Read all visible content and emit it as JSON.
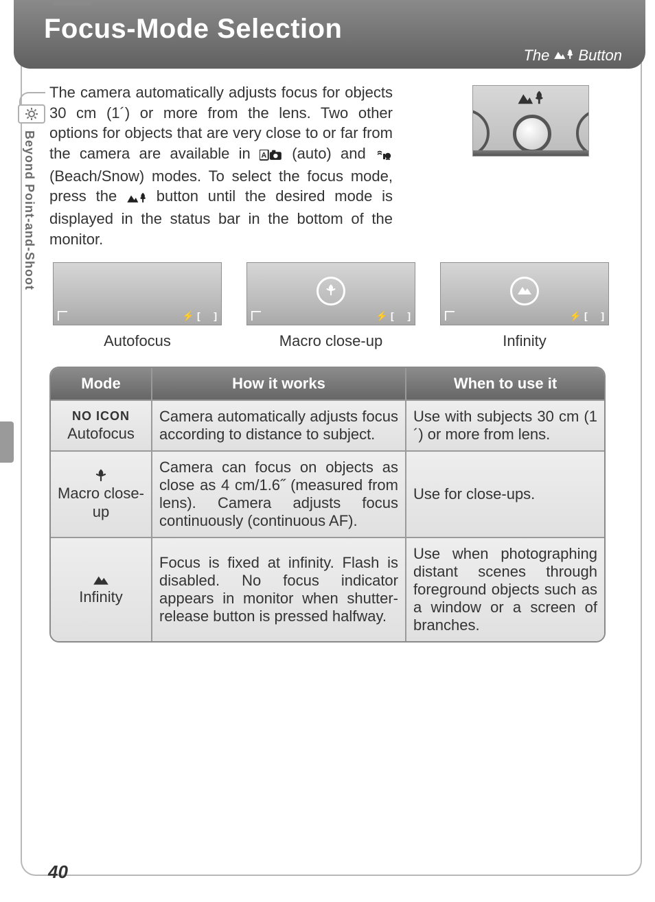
{
  "header": {
    "title": "Focus-Mode Selection",
    "subtitle_prefix": "The",
    "subtitle_suffix": "Button"
  },
  "side_tab": {
    "label": "Beyond Point-and-Shoot"
  },
  "intro": {
    "p1a": "The camera automatically adjusts focus for objects 30 cm (1´) or more from the lens.  Two other options for objects that are very close to or far from the camera are available in ",
    "p1b": " (auto) and ",
    "p1c": " (Beach/Snow) modes.  To select the focus mode, press the ",
    "p1d": " button until the desired mode is displayed in the status bar in the bottom of the monitor."
  },
  "previews": [
    {
      "label": "Autofocus",
      "center_icon": "none"
    },
    {
      "label": "Macro close-up",
      "center_icon": "macro"
    },
    {
      "label": "Infinity",
      "center_icon": "mountain"
    }
  ],
  "table": {
    "headers": {
      "mode": "Mode",
      "how": "How it works",
      "when": "When to use it"
    },
    "rows": [
      {
        "mode_icon": "none",
        "mode_top": "NO ICON",
        "mode_label": "Autofocus",
        "how": "Camera automatically adjusts focus according to distance to subject.",
        "when": "Use with subjects 30 cm (1´) or more from lens."
      },
      {
        "mode_icon": "macro",
        "mode_top": "",
        "mode_label": "Macro close-up",
        "how": "Camera can focus on objects as close as 4 cm/1.6˝ (measured from lens).  Camera adjusts focus continuously (continuous AF).",
        "when": "Use for close-ups."
      },
      {
        "mode_icon": "mountain",
        "mode_top": "",
        "mode_label": "Infinity",
        "how": "Focus is fixed at infinity.  Flash is disabled.  No focus indicator appears in monitor when shutter-release button is pressed halfway.",
        "when": "Use when photographing distant scenes through foreground objects such as a window or a screen of branches."
      }
    ]
  },
  "page_number": "40"
}
